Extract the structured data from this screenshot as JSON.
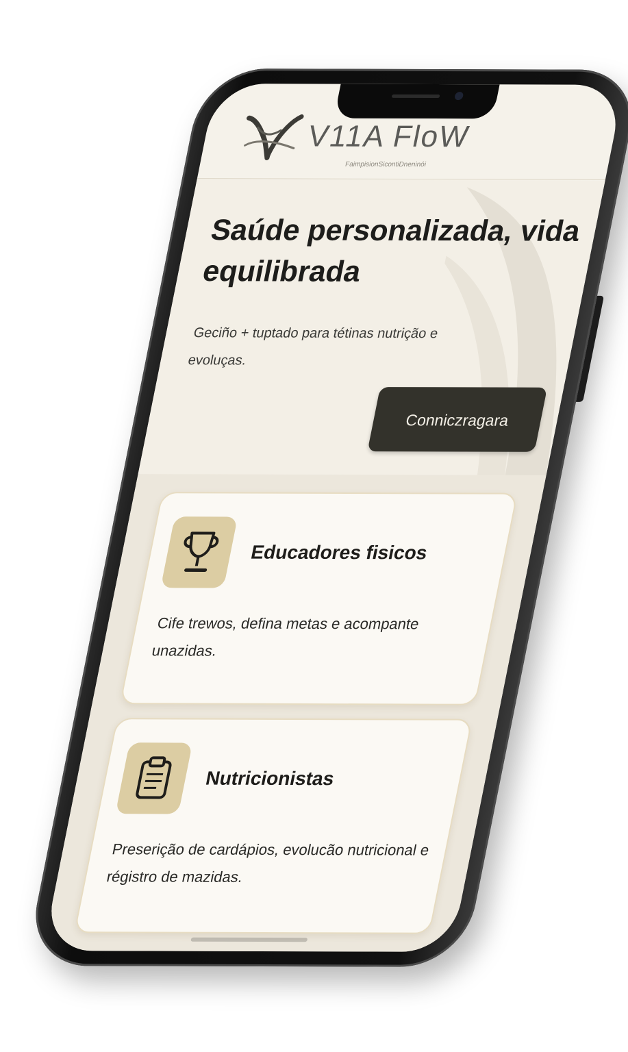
{
  "app": {
    "brand_name": "V11A FloW",
    "tagline": "FaimpisionSicontiDneninói"
  },
  "hero": {
    "title": "Saúde personalizada, vida equilibrada",
    "subtitle": "Geciño + tuptado para tétinas nutrição e evoluças.",
    "cta_label": "Conniczragara"
  },
  "cards": [
    {
      "title": "Educadores fisicos",
      "description": "Cife trewos, defina metas e acompante unazidas.",
      "icon": "trophy-icon"
    },
    {
      "title": "Nutricionistas",
      "description": "Preserição de cardápios, evolucão nutricional e régistro de mazidas.",
      "icon": "clipboard-icon"
    }
  ],
  "colors": {
    "screen_background": "#f5f2ea",
    "accent_dark": "#33322b",
    "icon_tile": "#dccda3",
    "card_border": "#e7dcc2"
  }
}
